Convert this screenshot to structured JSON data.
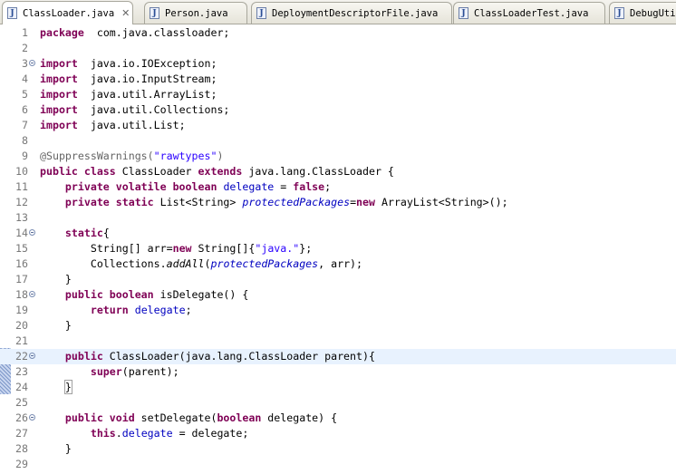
{
  "tabs": [
    {
      "label": "ClassLoader.java",
      "icon": "java-file-icon",
      "active": true,
      "closable": true
    },
    {
      "label": "Person.java",
      "icon": "java-file-icon",
      "active": false
    },
    {
      "label": "DeploymentDescriptorFile.java",
      "icon": "java-file-icon",
      "active": false
    },
    {
      "label": "ClassLoaderTest.java",
      "icon": "java-file-icon",
      "active": false
    },
    {
      "label": "DebugUtil",
      "icon": "java-file-icon",
      "active": false
    }
  ],
  "editor": {
    "current_line": 22,
    "lines": [
      {
        "n": "1",
        "fold": false,
        "tokens": [
          [
            "kw",
            "package"
          ],
          [
            "",
            "  com.java.classloader;"
          ]
        ]
      },
      {
        "n": "2",
        "fold": false,
        "tokens": []
      },
      {
        "n": "3",
        "fold": true,
        "tokens": [
          [
            "kw",
            "import"
          ],
          [
            "",
            "  java.io.IOException;"
          ]
        ]
      },
      {
        "n": "4",
        "fold": false,
        "tokens": [
          [
            "kw",
            "import"
          ],
          [
            "",
            "  java.io.InputStream;"
          ]
        ]
      },
      {
        "n": "5",
        "fold": false,
        "tokens": [
          [
            "kw",
            "import"
          ],
          [
            "",
            "  java.util.ArrayList;"
          ]
        ]
      },
      {
        "n": "6",
        "fold": false,
        "tokens": [
          [
            "kw",
            "import"
          ],
          [
            "",
            "  java.util.Collections;"
          ]
        ]
      },
      {
        "n": "7",
        "fold": false,
        "tokens": [
          [
            "kw",
            "import"
          ],
          [
            "",
            "  java.util.List;"
          ]
        ]
      },
      {
        "n": "8",
        "fold": false,
        "tokens": []
      },
      {
        "n": "9",
        "fold": false,
        "tokens": [
          [
            "ann",
            "@SuppressWarnings("
          ],
          [
            "str",
            "\"rawtypes\""
          ],
          [
            "ann",
            ")"
          ]
        ]
      },
      {
        "n": "10",
        "fold": false,
        "tokens": [
          [
            "kw",
            "public class"
          ],
          [
            "",
            " ClassLoader "
          ],
          [
            "kw",
            "extends"
          ],
          [
            "",
            " java.lang.ClassLoader {"
          ]
        ]
      },
      {
        "n": "11",
        "fold": false,
        "tokens": [
          [
            "",
            "    "
          ],
          [
            "kw",
            "private volatile boolean"
          ],
          [
            "",
            " "
          ],
          [
            "fld",
            "delegate"
          ],
          [
            "",
            " = "
          ],
          [
            "kw",
            "false"
          ],
          [
            "",
            ";"
          ]
        ]
      },
      {
        "n": "12",
        "fold": false,
        "tokens": [
          [
            "",
            "    "
          ],
          [
            "kw",
            "private static"
          ],
          [
            "",
            " List<String> "
          ],
          [
            "sfld",
            "protectedPackages"
          ],
          [
            "",
            "="
          ],
          [
            "kw",
            "new"
          ],
          [
            "",
            " ArrayList<String>();"
          ]
        ]
      },
      {
        "n": "13",
        "fold": false,
        "tokens": []
      },
      {
        "n": "14",
        "fold": true,
        "tokens": [
          [
            "",
            "    "
          ],
          [
            "kw",
            "static"
          ],
          [
            "",
            "{"
          ]
        ]
      },
      {
        "n": "15",
        "fold": false,
        "tokens": [
          [
            "",
            "        String[] arr="
          ],
          [
            "kw",
            "new"
          ],
          [
            "",
            " String[]{"
          ],
          [
            "str",
            "\"java.\""
          ],
          [
            "",
            "};"
          ]
        ]
      },
      {
        "n": "16",
        "fold": false,
        "tokens": [
          [
            "",
            "        Collections."
          ],
          [
            "smeth",
            "addAll"
          ],
          [
            "",
            "("
          ],
          [
            "sfld",
            "protectedPackages"
          ],
          [
            "",
            ", arr);"
          ]
        ]
      },
      {
        "n": "17",
        "fold": false,
        "tokens": [
          [
            "",
            "    }"
          ]
        ]
      },
      {
        "n": "18",
        "fold": true,
        "tokens": [
          [
            "",
            "    "
          ],
          [
            "kw",
            "public boolean"
          ],
          [
            "",
            " isDelegate() {"
          ]
        ]
      },
      {
        "n": "19",
        "fold": false,
        "tokens": [
          [
            "",
            "        "
          ],
          [
            "kw",
            "return"
          ],
          [
            "",
            " "
          ],
          [
            "fld",
            "delegate"
          ],
          [
            "",
            ";"
          ]
        ]
      },
      {
        "n": "20",
        "fold": false,
        "tokens": [
          [
            "",
            "    }"
          ]
        ]
      },
      {
        "n": "21",
        "fold": false,
        "tokens": []
      },
      {
        "n": "22",
        "fold": true,
        "tokens": [
          [
            "",
            "    "
          ],
          [
            "kw",
            "public"
          ],
          [
            "",
            " ClassLoader(java.lang.ClassLoader parent){"
          ]
        ]
      },
      {
        "n": "23",
        "fold": false,
        "tokens": [
          [
            "",
            "        "
          ],
          [
            "kw",
            "super"
          ],
          [
            "",
            "(parent);"
          ]
        ]
      },
      {
        "n": "24",
        "fold": false,
        "tokens": [
          [
            "",
            "    "
          ],
          [
            "bracket",
            "}"
          ]
        ]
      },
      {
        "n": "25",
        "fold": false,
        "tokens": []
      },
      {
        "n": "26",
        "fold": true,
        "tokens": [
          [
            "",
            "    "
          ],
          [
            "kw",
            "public void"
          ],
          [
            "",
            " setDelegate("
          ],
          [
            "kw",
            "boolean"
          ],
          [
            "",
            " delegate) {"
          ]
        ]
      },
      {
        "n": "27",
        "fold": false,
        "tokens": [
          [
            "",
            "        "
          ],
          [
            "kw",
            "this"
          ],
          [
            "",
            "."
          ],
          [
            "fld",
            "delegate"
          ],
          [
            "",
            " = delegate;"
          ]
        ]
      },
      {
        "n": "28",
        "fold": false,
        "tokens": [
          [
            "",
            "    }"
          ]
        ]
      },
      {
        "n": "29",
        "fold": false,
        "tokens": []
      }
    ]
  }
}
